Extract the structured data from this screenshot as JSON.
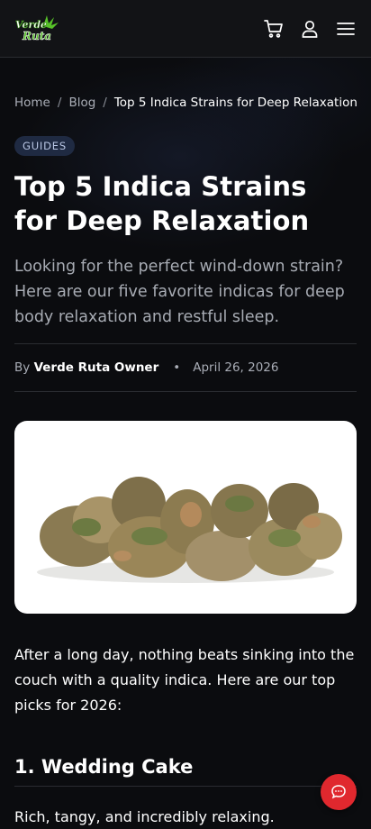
{
  "header": {
    "logo_line1": "Verde",
    "logo_line2": "Ruta",
    "icons": [
      "cart-icon",
      "user-icon",
      "menu-icon"
    ]
  },
  "breadcrumb": {
    "home": "Home",
    "blog": "Blog",
    "current": "Top 5 Indica Strains for Deep Relaxation"
  },
  "article": {
    "category": "GUIDES",
    "title": "Top 5 Indica Strains for Deep Relaxation",
    "subtitle": "Looking for the perfect wind-down strain? Here are our five favorite indicas for deep body relaxation and restful sleep.",
    "by_label": "By",
    "author": "Verde Ruta Owner",
    "separator": "•",
    "date": "April 26, 2026",
    "intro": "After a long day, nothing beats sinking into the couch with a quality indica. Here are our top picks for 2026:",
    "section1_heading": "1. Wedding Cake",
    "section1_text": "Rich, tangy, and incredibly relaxing."
  },
  "colors": {
    "background": "#0b0c0f",
    "accent": "#e0282e",
    "badge": "#1f2a42",
    "logo_green": "#57c229"
  }
}
